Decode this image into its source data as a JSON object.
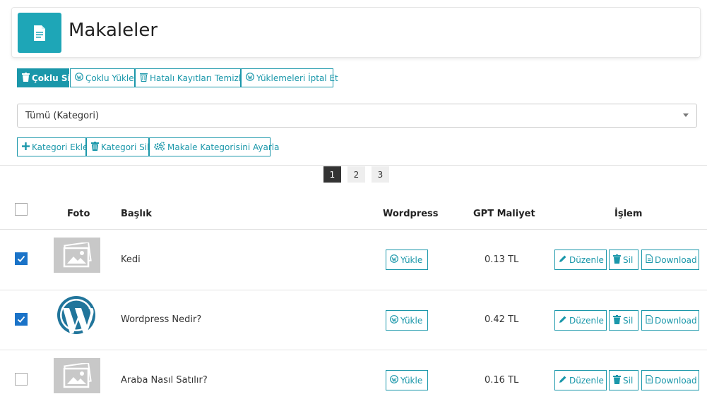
{
  "header": {
    "title": "Makaleler",
    "icon": "document-icon",
    "accent": "#1ea6b7"
  },
  "toolbar": {
    "bulk_delete": "Çoklu Sil",
    "bulk_upload": "Çoklu Yükle",
    "clean_errors": "Hatalı Kayıtları Temizle",
    "cancel_uploads": "Yüklemeleri İptal Et"
  },
  "category_filter": {
    "selected": "Tümü (Kategori)"
  },
  "category_actions": {
    "add": "Kategori Ekle",
    "delete": "Kategori Sil",
    "set": "Makale Kategorisini Ayarla"
  },
  "pagination": {
    "pages": [
      "1",
      "2",
      "3"
    ],
    "current": "1"
  },
  "table": {
    "columns": {
      "photo": "Foto",
      "title": "Başlık",
      "wordpress": "Wordpress",
      "cost": "GPT Maliyet",
      "actions": "İşlem"
    },
    "rows": [
      {
        "checked": true,
        "photo": "image-placeholder-icon",
        "title": "Kedi",
        "upload": "Yükle",
        "cost": "0.13 TL",
        "edit": "Düzenle",
        "delete": "Sil",
        "download": "Download"
      },
      {
        "checked": true,
        "photo": "wordpress-logo",
        "title": "Wordpress Nedir?",
        "upload": "Yükle",
        "cost": "0.42 TL",
        "edit": "Düzenle",
        "delete": "Sil",
        "download": "Download"
      },
      {
        "checked": false,
        "photo": "image-placeholder-icon",
        "title": "Araba Nasıl Satılır?",
        "upload": "Yükle",
        "cost": "0.16 TL",
        "edit": "Düzenle",
        "delete": "Sil",
        "download": "Download"
      }
    ]
  }
}
